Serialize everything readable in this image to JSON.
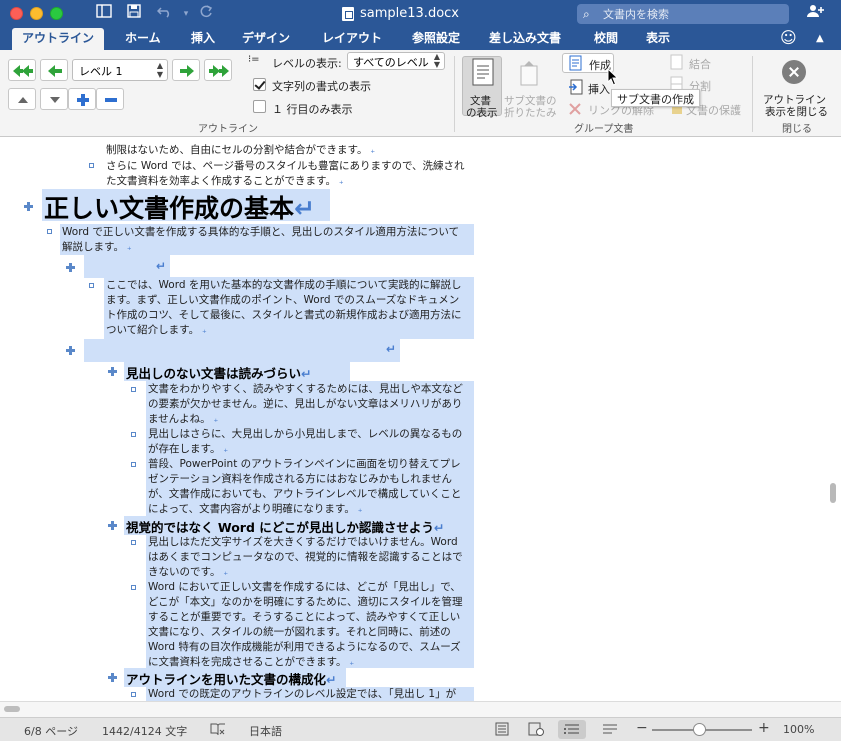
{
  "window": {
    "title": "sample13.docx",
    "search_placeholder": "文書内を検索"
  },
  "tabs": [
    {
      "label": "アウトライン",
      "active": true
    },
    {
      "label": "ホーム"
    },
    {
      "label": "挿入"
    },
    {
      "label": "デザイン"
    },
    {
      "label": "レイアウト"
    },
    {
      "label": "参照設定"
    },
    {
      "label": "差し込み文書"
    },
    {
      "label": "校閲"
    },
    {
      "label": "表示"
    }
  ],
  "ribbon": {
    "outline_group": {
      "level_value": "レベル 1",
      "show_level_label": "レベルの表示:",
      "show_level_value": "すべてのレベル",
      "show_formatting_label": "文字列の書式の表示",
      "show_formatting_checked": true,
      "first_line_only_label": "１ 行目のみ表示",
      "first_line_only_checked": false,
      "group_label": "アウトライン"
    },
    "master_group": {
      "show_document_label_1": "文書",
      "show_document_label_2": "の表示",
      "collapse_sub_label_1": "サブ文書の",
      "collapse_sub_label_2": "折りたたみ",
      "create_label": "作成",
      "insert_label": "挿入",
      "unlink_label": "リンクの解除",
      "merge_label": "結合",
      "split_label": "分割",
      "lock_label": "文書の保護",
      "group_label": "グループ文書",
      "tooltip": "サブ文書の作成"
    },
    "close_group": {
      "close_label_1": "アウトライン",
      "close_label_2": "表示を閉じる",
      "group_label": "閉じる"
    }
  },
  "document": {
    "lines": [
      {
        "text": "制限はないため、自由にセルの分割や結合ができます。"
      },
      {
        "text": "さらに Word では、ページ番号のスタイルも豊富にありますので、洗練され"
      },
      {
        "text": "た文書資料を効率よく作成することができます。"
      },
      {
        "text": "正しい文書作成の基本"
      },
      {
        "text": "Word で正しい文書を作成する具体的な手順と、見出しのスタイル適用方法について"
      },
      {
        "text": "解説します。"
      },
      {
        "text": "ここでは、Word を用いた基本的な文書作成の手順について実践的に解説し"
      },
      {
        "text": "ます。まず、正しい文書作成のポイント、Word でのスムーズなドキュメン"
      },
      {
        "text": "ト作成のコツ、そして最後に、スタイルと書式の新規作成および適用方法に"
      },
      {
        "text": "ついて紹介します。"
      },
      {
        "text": "見出しのない文書は読みづらい"
      },
      {
        "text": "文書をわかりやすく、読みやすくするためには、見出しや本文など"
      },
      {
        "text": "の要素が欠かせません。逆に、見出しがない文章はメリハリがあり"
      },
      {
        "text": "ませんよね。"
      },
      {
        "text": "見出しはさらに、大見出しから小見出しまで、レベルの異なるもの"
      },
      {
        "text": "が存在します。"
      },
      {
        "text": "普段、PowerPoint のアウトラインペインに画面を切り替えてプレ"
      },
      {
        "text": "ゼンテーション資料を作成される方にはおなじみかもしれません"
      },
      {
        "text": "が、文書作成においても、アウトラインレベルで構成していくこと"
      },
      {
        "text": "によって、文書内容がより明確になります。"
      },
      {
        "text": "視覚的ではなく Word にどこが見出しか認識させよう"
      },
      {
        "text": "見出しはただ文字サイズを大きくするだけではいけません。Word"
      },
      {
        "text": "はあくまでコンピュータなので、視覚的に情報を認識することはで"
      },
      {
        "text": "きないのです。"
      },
      {
        "text": "Word において正しい文書を作成するには、どこが「見出し」で、"
      },
      {
        "text": "どこが「本文」なのかを明確にするために、適切にスタイルを管理"
      },
      {
        "text": "することが重要です。そうすることによって、読みやすくて正しい"
      },
      {
        "text": "文書になり、スタイルの統一が図れます。それと同時に、前述の"
      },
      {
        "text": "Word 特有の目次作成機能が利用できるようになるので、スムーズ"
      },
      {
        "text": "に文書資料を完成させることができます。"
      },
      {
        "text": "アウトラインを用いた文書の構成化"
      },
      {
        "text": "Word での既定のアウトラインのレベル設定では、「見出し 1」が"
      }
    ]
  },
  "statusbar": {
    "page": "6/8 ページ",
    "words": "1442/4124 文字",
    "language": "日本語",
    "zoom": "100%",
    "zoom_fraction": 0.47
  },
  "colors": {
    "titlebar": "#2b5797",
    "selection": "#cfe0f9",
    "bullet": "#5a88c9",
    "return_mark": "#4a7ecf"
  }
}
